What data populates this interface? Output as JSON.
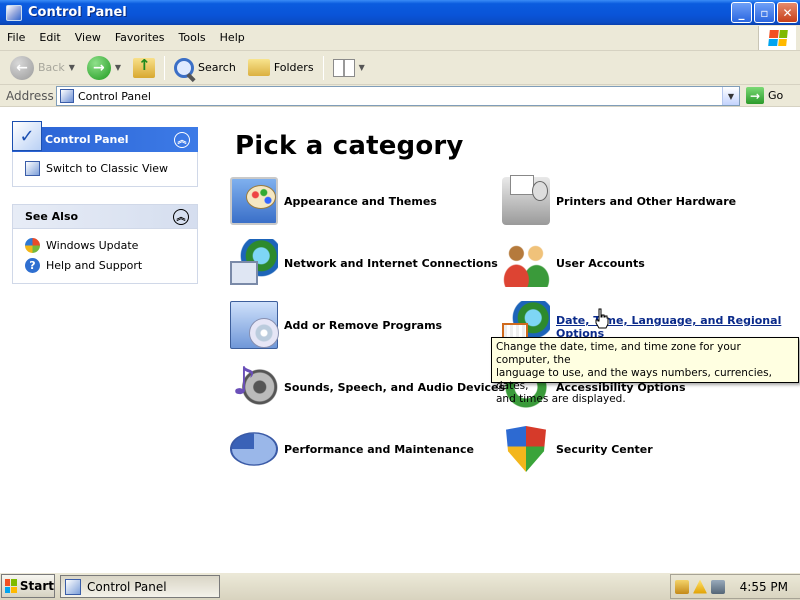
{
  "window": {
    "title": "Control Panel",
    "buttons": {
      "minimize": "_",
      "maximize": "▫",
      "close": "✕"
    }
  },
  "menu": [
    "File",
    "Edit",
    "View",
    "Favorites",
    "Tools",
    "Help"
  ],
  "toolbar": {
    "back": "Back",
    "search": "Search",
    "folders": "Folders"
  },
  "address": {
    "label": "Address",
    "value": "Control Panel",
    "go": "Go"
  },
  "sidebar": {
    "control_panel": {
      "title": "Control Panel",
      "items": [
        {
          "label": "Switch to Classic View",
          "icon": "classic-view-icon"
        }
      ]
    },
    "see_also": {
      "title": "See Also",
      "items": [
        {
          "label": "Windows Update",
          "icon": "windows-update-icon"
        },
        {
          "label": "Help and Support",
          "icon": "help-icon"
        }
      ]
    }
  },
  "main": {
    "heading": "Pick a category",
    "categories": [
      {
        "label": "Appearance and Themes",
        "icon": "appearance-themes-icon"
      },
      {
        "label": "Network and Internet Connections",
        "icon": "network-icon"
      },
      {
        "label": "Add or Remove Programs",
        "icon": "add-remove-programs-icon"
      },
      {
        "label": "Sounds, Speech, and Audio Devices",
        "icon": "sounds-icon"
      },
      {
        "label": "Performance and Maintenance",
        "icon": "performance-icon"
      },
      {
        "label": "Printers and Other Hardware",
        "icon": "printer-icon"
      },
      {
        "label": "User Accounts",
        "icon": "user-accounts-icon"
      },
      {
        "label_line1": "Date, Time, Language, and Regional",
        "label_line2": "Options",
        "icon": "date-time-icon"
      },
      {
        "label": "Accessibility Options",
        "icon": "accessibility-icon"
      },
      {
        "label": "Security Center",
        "icon": "security-center-icon"
      }
    ],
    "tooltip": {
      "line1": "Change the date, time, and time zone for your computer, the",
      "line2": "language to use, and the ways numbers, currencies, dates,",
      "line3": "and times are displayed."
    }
  },
  "taskbar": {
    "start": "Start",
    "task": "Control Panel",
    "clock": "4:55 PM"
  }
}
